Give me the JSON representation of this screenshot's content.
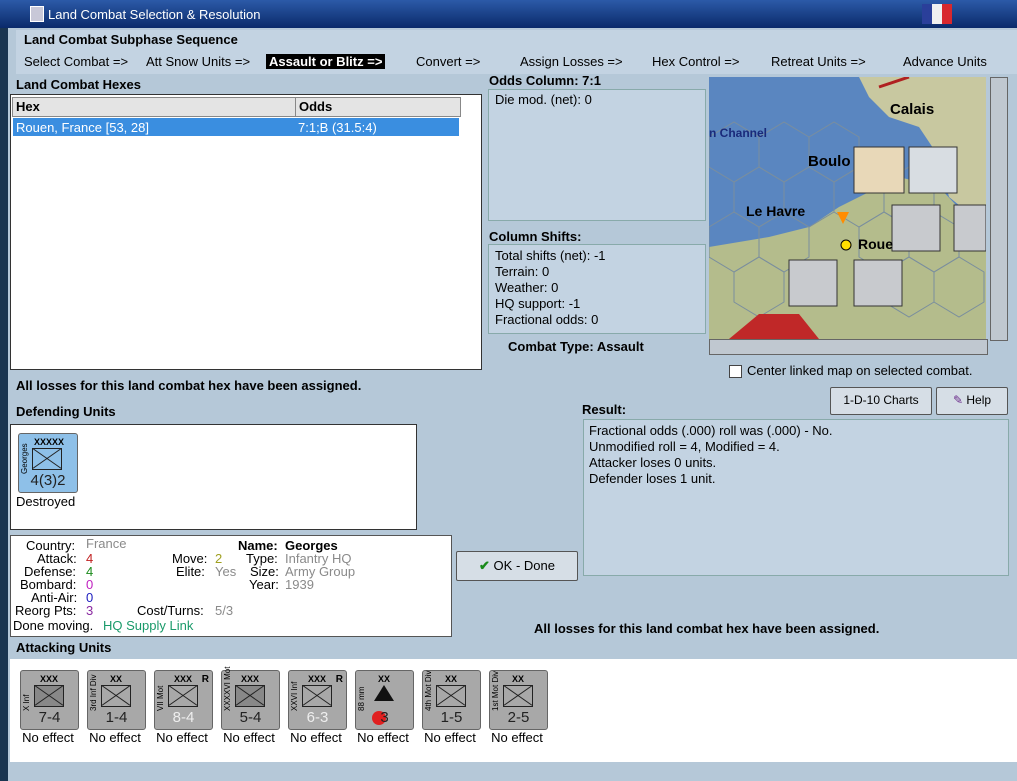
{
  "window": {
    "title": "Land Combat Selection & Resolution"
  },
  "sequence": {
    "title": "Land Combat Subphase Sequence",
    "steps": [
      "Select Combat =>",
      "Att Snow Units =>",
      "Assault or Blitz =>",
      "Convert =>",
      "Assign Losses =>",
      "Hex Control =>",
      "Retreat Units =>",
      "Advance Units"
    ],
    "active_index": 2
  },
  "hexes": {
    "title": "Land Combat Hexes",
    "columns": [
      "Hex",
      "Odds"
    ],
    "rows": [
      {
        "hex": "Rouen, France [53, 28]",
        "odds": "7:1;B (31.5:4)"
      }
    ]
  },
  "odds": {
    "title": "Odds Column: 7:1",
    "die_mod": "Die mod. (net): 0"
  },
  "shifts": {
    "title": "Column Shifts:",
    "lines": [
      "Total shifts (net): -1",
      "Terrain: 0",
      "Weather: 0",
      "HQ support: -1",
      "Fractional odds: 0"
    ]
  },
  "combat_type": "Combat Type:  Assault",
  "map": {
    "labels": [
      "Calais",
      "Boulo",
      "Le Havre",
      "Roue",
      "n Channel"
    ],
    "center_checkbox_label": "Center linked map on selected combat.",
    "center_checked": false
  },
  "losses_msg": "All losses for this land combat hex have been assigned.",
  "defending": {
    "title": "Defending Units",
    "units": [
      {
        "size": "XXXXX",
        "name": "Georges",
        "strength": "4(3)2",
        "status": "Destroyed"
      }
    ]
  },
  "buttons": {
    "charts": "1-D-10 Charts",
    "help": "Help",
    "ok": "OK - Done"
  },
  "result": {
    "title": "Result:",
    "lines": [
      "Fractional odds (.000) roll was (.000)  - No.",
      "Unmodified roll = 4, Modified = 4.",
      "Attacker loses 0 units.",
      "Defender loses 1 unit."
    ]
  },
  "info": {
    "country_label": "Country:",
    "country": "France",
    "attack_label": "Attack:",
    "attack": "4",
    "defense_label": "Defense:",
    "defense": "4",
    "bombard_label": "Bombard:",
    "bombard": "0",
    "antiair_label": "Anti-Air:",
    "antiair": "0",
    "reorg_label": "Reorg Pts:",
    "reorg": "3",
    "done_label": "Done moving.",
    "supply": "HQ Supply Link",
    "move_label": "Move:",
    "move": "2",
    "elite_label": "Elite:",
    "elite": "Yes",
    "cost_label": "Cost/Turns:",
    "cost": "5/3",
    "name_label": "Name:",
    "name": "Georges",
    "type_label": "Type:",
    "type": "Infantry HQ",
    "size_label": "Size:",
    "size": "Army Group",
    "year_label": "Year:",
    "year": "1939"
  },
  "attacking": {
    "title": "Attacking Units",
    "units": [
      {
        "size": "XXX",
        "name": "X Inf",
        "strength": "7-4",
        "status": "No effect",
        "flag": ""
      },
      {
        "size": "XX",
        "name": "3rd Inf Div",
        "strength": "1-4",
        "status": "No effect",
        "flag": ""
      },
      {
        "size": "XXX",
        "name": "VII Mot",
        "strength": "8-4",
        "status": "No effect",
        "flag": "R"
      },
      {
        "size": "XXX",
        "name": "XXXXVI Mot",
        "strength": "5-4",
        "status": "No effect",
        "flag": ""
      },
      {
        "size": "XXX",
        "name": "XXVI Inf",
        "strength": "6-3",
        "status": "No effect",
        "flag": "R"
      },
      {
        "size": "XX",
        "name": "88 mm",
        "strength": "3",
        "status": "No effect",
        "flag": ""
      },
      {
        "size": "XX",
        "name": "4th Mot Div",
        "strength": "1-5",
        "status": "No effect",
        "flag": ""
      },
      {
        "size": "XX",
        "name": "1st Mot Div",
        "strength": "2-5",
        "status": "No effect",
        "flag": ""
      }
    ]
  }
}
